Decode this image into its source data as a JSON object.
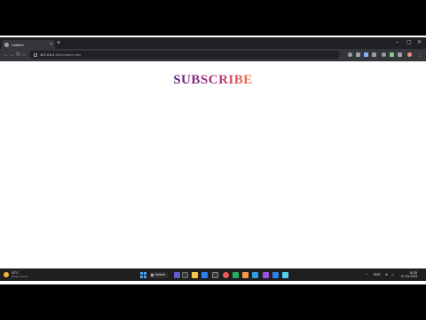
{
  "browser": {
    "tab_title": "Untitled",
    "tab_close": "×",
    "new_tab": "+",
    "url_host": "127.0.0.1",
    "url_path": ":5500/index.html",
    "window_controls": [
      "–",
      "▢",
      "✕"
    ],
    "nav_icons": [
      "back-icon",
      "forward-icon",
      "reload-icon",
      "home-icon"
    ]
  },
  "page": {
    "headline": "SUBSCRIBE",
    "headline_colors": [
      "#5b1f8a",
      "#b1307a",
      "#ff6f3f"
    ]
  },
  "taskbar": {
    "weather_temp": "31°C",
    "weather_desc": "Mostly cloudy",
    "search_label": "Search",
    "tray_lang": "ENG",
    "clock_time": "10:25",
    "clock_date": "07-03-2023"
  }
}
